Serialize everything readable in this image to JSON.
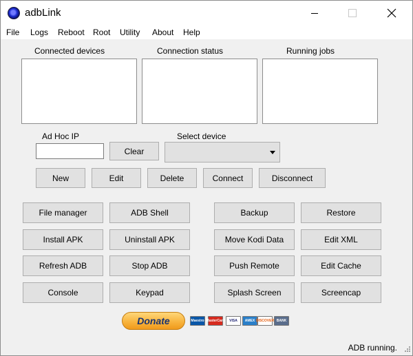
{
  "window": {
    "title": "adbLink"
  },
  "menu": [
    "File",
    "Logs",
    "Reboot",
    "Root",
    "Utility",
    "About",
    "Help"
  ],
  "panels": {
    "connected_devices": "Connected devices",
    "connection_status": "Connection status",
    "running_jobs": "Running jobs"
  },
  "adhoc": {
    "label": "Ad Hoc IP",
    "value": "",
    "clear_label": "Clear"
  },
  "select_device": {
    "label": "Select device",
    "value": ""
  },
  "device_buttons": {
    "new": "New",
    "edit": "Edit",
    "delete": "Delete",
    "connect": "Connect",
    "disconnect": "Disconnect"
  },
  "actions": {
    "file_manager": "File manager",
    "adb_shell": "ADB Shell",
    "backup": "Backup",
    "restore": "Restore",
    "install_apk": "Install APK",
    "uninstall_apk": "Uninstall APK",
    "move_kodi_data": "Move Kodi Data",
    "edit_xml": "Edit XML",
    "refresh_adb": "Refresh ADB",
    "stop_adb": "Stop ADB",
    "push_remote": "Push Remote",
    "edit_cache": "Edit Cache",
    "console": "Console",
    "keypad": "Keypad",
    "splash_screen": "Splash Screen",
    "screencap": "Screencap"
  },
  "donate": {
    "label": "Donate",
    "cards": [
      "Maestro",
      "MasterCard",
      "VISA",
      "AMEX",
      "DISCOVER",
      "BANK"
    ]
  },
  "status": {
    "text": "ADB running."
  }
}
